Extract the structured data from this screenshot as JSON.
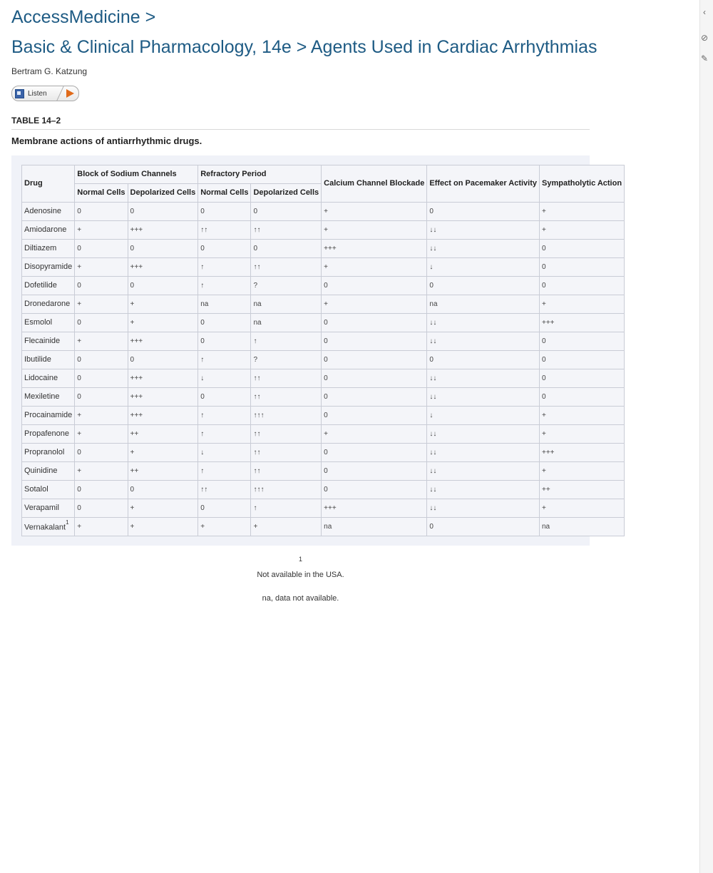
{
  "breadcrumb": {
    "site": "AccessMedicine >",
    "book_path": "Basic & Clinical Pharmacology, 14e > Agents Used in Cardiac Arrhythmias"
  },
  "author": "Bertram G. Katzung",
  "listen_label": "Listen",
  "table": {
    "label": "TABLE 14–2",
    "caption": "Membrane actions of antiarrhythmic drugs.",
    "group_headers": {
      "drug": "Drug",
      "sodium": "Block of Sodium Channels",
      "refractory": "Refractory Period",
      "calcium": "Calcium Channel Blockade",
      "pacemaker": "Effect on Pacemaker Activity",
      "sympatholytic": "Sympatholytic Action"
    },
    "sub_headers": [
      "Normal Cells",
      "Depolarized Cells",
      "Normal Cells",
      "Depolarized Cells"
    ],
    "rows": [
      {
        "drug": "Adenosine",
        "cells": [
          "0",
          "0",
          "0",
          "0",
          "+",
          "0",
          "+"
        ]
      },
      {
        "drug": "Amiodarone",
        "cells": [
          "+",
          "+++",
          "↑↑",
          "↑↑",
          "+",
          "↓↓",
          "+"
        ]
      },
      {
        "drug": "Diltiazem",
        "cells": [
          "0",
          "0",
          "0",
          "0",
          "+++",
          "↓↓",
          "0"
        ]
      },
      {
        "drug": "Disopyramide",
        "cells": [
          "+",
          "+++",
          "↑",
          "↑↑",
          "+",
          "↓",
          "0"
        ]
      },
      {
        "drug": "Dofetilide",
        "cells": [
          "0",
          "0",
          "↑",
          "?",
          "0",
          "0",
          "0"
        ]
      },
      {
        "drug": "Dronedarone",
        "cells": [
          "+",
          "+",
          "na",
          "na",
          "+",
          "na",
          "+"
        ]
      },
      {
        "drug": "Esmolol",
        "cells": [
          "0",
          "+",
          "0",
          "na",
          "0",
          "↓↓",
          "+++"
        ]
      },
      {
        "drug": "Flecainide",
        "cells": [
          "+",
          "+++",
          "0",
          "↑",
          "0",
          "↓↓",
          "0"
        ]
      },
      {
        "drug": "Ibutilide",
        "cells": [
          "0",
          "0",
          "↑",
          "?",
          "0",
          "0",
          "0"
        ]
      },
      {
        "drug": "Lidocaine",
        "cells": [
          "0",
          "+++",
          "↓",
          "↑↑",
          "0",
          "↓↓",
          "0"
        ]
      },
      {
        "drug": "Mexiletine",
        "cells": [
          "0",
          "+++",
          "0",
          "↑↑",
          "0",
          "↓↓",
          "0"
        ]
      },
      {
        "drug": "Procainamide",
        "cells": [
          "+",
          "+++",
          "↑",
          "↑↑↑",
          "0",
          "↓",
          "+"
        ]
      },
      {
        "drug": "Propafenone",
        "cells": [
          "+",
          "++",
          "↑",
          "↑↑",
          "+",
          "↓↓",
          "+"
        ]
      },
      {
        "drug": "Propranolol",
        "cells": [
          "0",
          "+",
          "↓",
          "↑↑",
          "0",
          "↓↓",
          "+++"
        ]
      },
      {
        "drug": "Quinidine",
        "cells": [
          "+",
          "++",
          "↑",
          "↑↑",
          "0",
          "↓↓",
          "+"
        ]
      },
      {
        "drug": "Sotalol",
        "cells": [
          "0",
          "0",
          "↑↑",
          "↑↑↑",
          "0",
          "↓↓",
          "++"
        ]
      },
      {
        "drug": "Verapamil",
        "cells": [
          "0",
          "+",
          "0",
          "↑",
          "+++",
          "↓↓",
          "+"
        ]
      },
      {
        "drug": "Vernakalant",
        "sup": "1",
        "cells": [
          "+",
          "+",
          "+",
          "+",
          "na",
          "0",
          "na"
        ]
      }
    ]
  },
  "footnotes": {
    "mark": "1",
    "text": "Not available in the USA.",
    "na_note": "na, data not available."
  },
  "sidebar": {
    "collapse_icon": "‹",
    "hide_icon": "⊘",
    "note_icon": "✎"
  },
  "colors": {
    "title": "#1e5b84",
    "table_bg": "#f0f2f8",
    "play_icon": "#e06a1a"
  }
}
